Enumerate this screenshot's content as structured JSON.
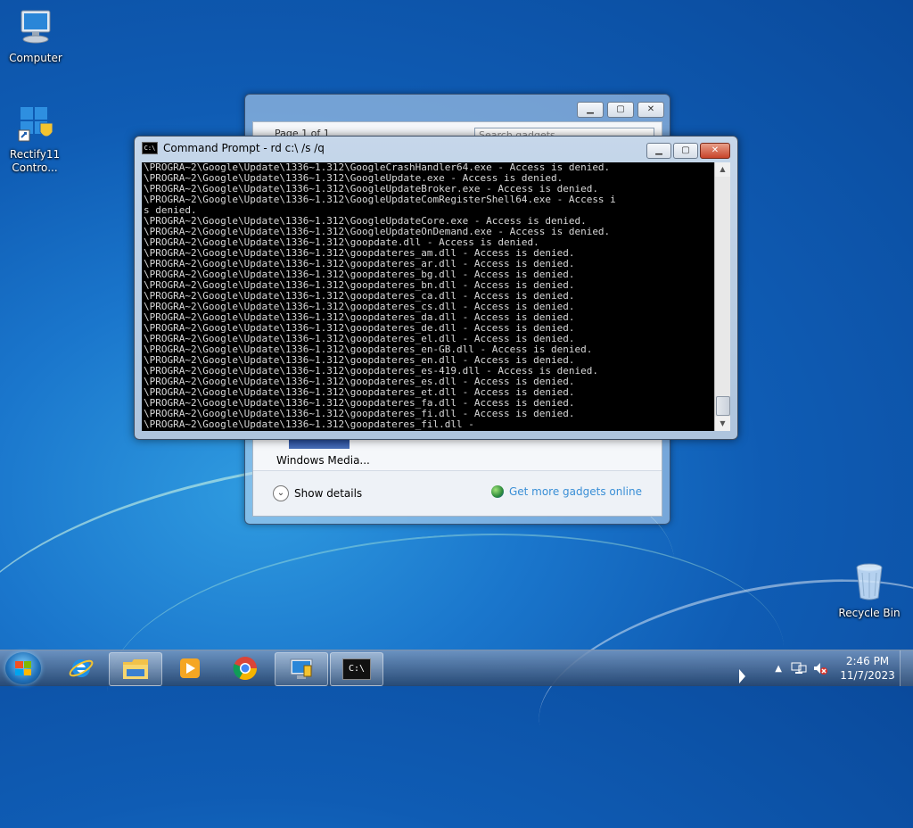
{
  "desktop": {
    "icons": [
      {
        "label": "Computer",
        "icon": "computer-icon"
      },
      {
        "label": "Rectify11 Contro...",
        "icon": "control-panel-icon"
      },
      {
        "label": "Recycle Bin",
        "icon": "recycle-bin-icon"
      }
    ]
  },
  "gadget_window": {
    "pager": "Page 1 of 1",
    "search_placeholder": "Search gadgets",
    "tile_label": "Windows Media...",
    "show_details": "Show details",
    "more_gadgets": "Get more gadgets online"
  },
  "cmd_window": {
    "title": "Command Prompt - rd  c:\\ /s /q",
    "lines": [
      "\\PROGRA~2\\Google\\Update\\1336~1.312\\GoogleCrashHandler64.exe - Access is denied.",
      "\\PROGRA~2\\Google\\Update\\1336~1.312\\GoogleUpdate.exe - Access is denied.",
      "\\PROGRA~2\\Google\\Update\\1336~1.312\\GoogleUpdateBroker.exe - Access is denied.",
      "\\PROGRA~2\\Google\\Update\\1336~1.312\\GoogleUpdateComRegisterShell64.exe - Access i",
      "s denied.",
      "\\PROGRA~2\\Google\\Update\\1336~1.312\\GoogleUpdateCore.exe - Access is denied.",
      "\\PROGRA~2\\Google\\Update\\1336~1.312\\GoogleUpdateOnDemand.exe - Access is denied.",
      "\\PROGRA~2\\Google\\Update\\1336~1.312\\goopdate.dll - Access is denied.",
      "\\PROGRA~2\\Google\\Update\\1336~1.312\\goopdateres_am.dll - Access is denied.",
      "\\PROGRA~2\\Google\\Update\\1336~1.312\\goopdateres_ar.dll - Access is denied.",
      "\\PROGRA~2\\Google\\Update\\1336~1.312\\goopdateres_bg.dll - Access is denied.",
      "\\PROGRA~2\\Google\\Update\\1336~1.312\\goopdateres_bn.dll - Access is denied.",
      "\\PROGRA~2\\Google\\Update\\1336~1.312\\goopdateres_ca.dll - Access is denied.",
      "\\PROGRA~2\\Google\\Update\\1336~1.312\\goopdateres_cs.dll - Access is denied.",
      "\\PROGRA~2\\Google\\Update\\1336~1.312\\goopdateres_da.dll - Access is denied.",
      "\\PROGRA~2\\Google\\Update\\1336~1.312\\goopdateres_de.dll - Access is denied.",
      "\\PROGRA~2\\Google\\Update\\1336~1.312\\goopdateres_el.dll - Access is denied.",
      "\\PROGRA~2\\Google\\Update\\1336~1.312\\goopdateres_en-GB.dll - Access is denied.",
      "\\PROGRA~2\\Google\\Update\\1336~1.312\\goopdateres_en.dll - Access is denied.",
      "\\PROGRA~2\\Google\\Update\\1336~1.312\\goopdateres_es-419.dll - Access is denied.",
      "\\PROGRA~2\\Google\\Update\\1336~1.312\\goopdateres_es.dll - Access is denied.",
      "\\PROGRA~2\\Google\\Update\\1336~1.312\\goopdateres_et.dll - Access is denied.",
      "\\PROGRA~2\\Google\\Update\\1336~1.312\\goopdateres_fa.dll - Access is denied.",
      "\\PROGRA~2\\Google\\Update\\1336~1.312\\goopdateres_fi.dll - Access is denied.",
      "\\PROGRA~2\\Google\\Update\\1336~1.312\\goopdateres_fil.dll -"
    ]
  },
  "taskbar": {
    "apps": [
      {
        "name": "internet-explorer",
        "icon": "internet-explorer-icon",
        "active": false
      },
      {
        "name": "file-explorer",
        "icon": "folder-icon",
        "active": true
      },
      {
        "name": "media-player",
        "icon": "media-player-icon",
        "active": false
      },
      {
        "name": "chrome",
        "icon": "chrome-icon",
        "active": false
      },
      {
        "name": "control-panel",
        "icon": "control-panel-icon",
        "active": true
      },
      {
        "name": "command-prompt",
        "icon": "cmd-icon",
        "active": true
      }
    ],
    "time": "2:46 PM",
    "date": "11/7/2023"
  }
}
